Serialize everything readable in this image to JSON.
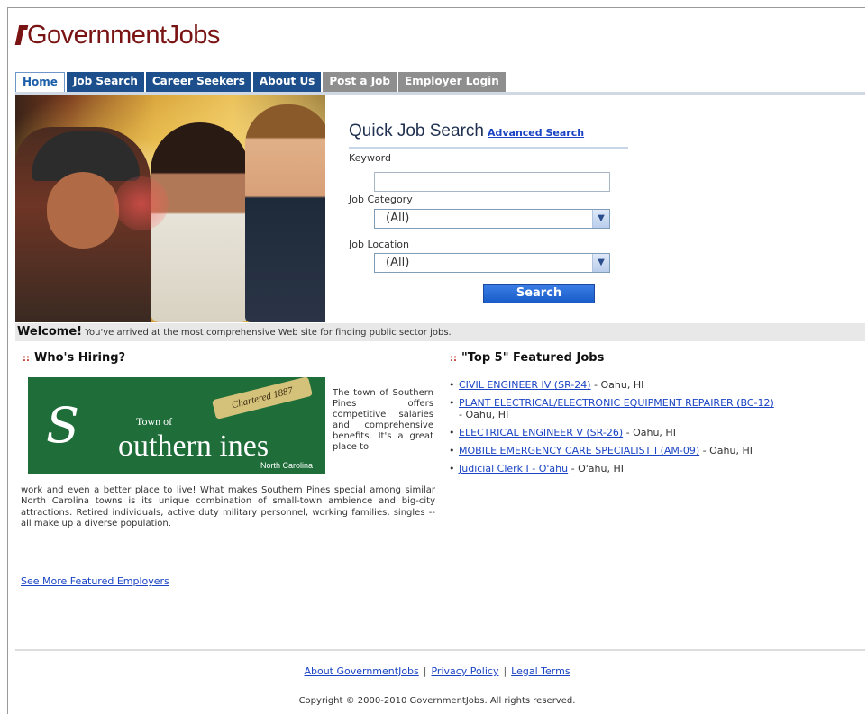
{
  "header": {
    "logo_text": "GovernmentJobs"
  },
  "nav": {
    "tabs": [
      {
        "label": "Home",
        "style": "active"
      },
      {
        "label": "Job Search",
        "style": "blue"
      },
      {
        "label": "Career Seekers",
        "style": "blue"
      },
      {
        "label": "About Us",
        "style": "blue"
      },
      {
        "label": "Post a Job",
        "style": "gray"
      },
      {
        "label": "Employer Login",
        "style": "gray"
      }
    ]
  },
  "quick_search": {
    "title": "Quick Job Search",
    "advanced_link": "Advanced Search",
    "keyword_label": "Keyword",
    "keyword_value": "",
    "category_label": "Job Category",
    "category_value": "(All)",
    "location_label": "Job Location",
    "location_value": "(All)",
    "search_button": "Search"
  },
  "welcome": {
    "bold": "Welcome!",
    "text": "You've arrived at the most comprehensive Web site for finding public sector jobs."
  },
  "whos_hiring": {
    "title": "Who's Hiring?",
    "logo": {
      "script": "S",
      "town": "Town of",
      "name": "outhern  ines",
      "state": "North Carolina",
      "banner": "Chartered 1887"
    },
    "intro_side": "The town of Southern Pines offers competitive salaries and comprehensive benefits. It's a great place to",
    "intro_main": "work and even a better place to live! What makes Southern Pines special among similar North Carolina towns is its unique combination of small-town ambience and big-city attractions. Retired individuals, active duty military personnel, working families, singles -- all make up a diverse population.",
    "more_link": "See More Featured Employers"
  },
  "featured": {
    "title": "\"Top 5\" Featured Jobs",
    "jobs": [
      {
        "title": "CIVIL ENGINEER IV (SR-24)",
        "location": "- Oahu, HI"
      },
      {
        "title": "PLANT ELECTRICAL/ELECTRONIC EQUIPMENT REPAIRER (BC-12)",
        "location": "- Oahu, HI"
      },
      {
        "title": "ELECTRICAL ENGINEER V (SR-26)",
        "location": "- Oahu, HI"
      },
      {
        "title": "MOBILE EMERGENCY CARE SPECIALIST I (AM-09)",
        "location": "- Oahu, HI"
      },
      {
        "title": "Judicial Clerk I - O'ahu",
        "location": "- O'ahu, HI"
      }
    ]
  },
  "footer": {
    "links": [
      "About GovernmentJobs",
      "Privacy Policy",
      "Legal Terms"
    ],
    "separator": "|",
    "copyright": "Copyright © 2000-2010 GovernmentJobs. All rights reserved."
  },
  "colors": {
    "logo": "#7a1414",
    "tab_blue": "#1d4f8c",
    "tab_gray": "#8e8e8e",
    "link": "#1a44c4",
    "button": "#1a5cc8",
    "logo_green": "#1f6e3a"
  }
}
